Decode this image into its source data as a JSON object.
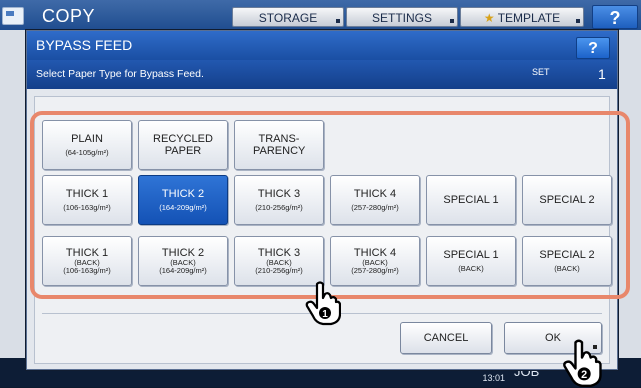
{
  "topbar": {
    "title": "COPY",
    "buttons": [
      "STORAGE",
      "SETTINGS",
      "TEMPLATE"
    ],
    "help_label": "?"
  },
  "dialog": {
    "title": "BYPASS FEED",
    "help_label": "?",
    "instruction": "Select Paper Type for Bypass Feed.",
    "set_label": "SET",
    "set_value": "1"
  },
  "paper_types": [
    {
      "label": "PLAIN",
      "weight": "(64-105g/m²)"
    },
    {
      "label": "RECYCLED PAPER"
    },
    {
      "label": "TRANS- PARENCY"
    },
    {
      "label": "THICK 1",
      "weight": "(106-163g/m²)"
    },
    {
      "label": "THICK 2",
      "weight": "(164-209g/m²)",
      "selected": true
    },
    {
      "label": "THICK 3",
      "weight": "(210-256g/m²)"
    },
    {
      "label": "THICK 4",
      "weight": "(257-280g/m²)"
    },
    {
      "label": "SPECIAL 1"
    },
    {
      "label": "SPECIAL 2"
    },
    {
      "label": "THICK 1",
      "back": "(BACK)",
      "weight": "(106-163g/m²)"
    },
    {
      "label": "THICK 2",
      "back": "(BACK)",
      "weight": "(164-209g/m²)"
    },
    {
      "label": "THICK 3",
      "back": "(BACK)",
      "weight": "(210-256g/m²)"
    },
    {
      "label": "THICK 4",
      "back": "(BACK)",
      "weight": "(257-280g/m²)"
    },
    {
      "label": "SPECIAL 1",
      "back": "(BACK)"
    },
    {
      "label": "SPECIAL 2",
      "back": "(BACK)"
    }
  ],
  "actions": {
    "cancel": "CANCEL",
    "ok": "OK"
  },
  "callouts": {
    "step1": "1",
    "step2": "2"
  },
  "status": {
    "time": "13:01",
    "job": "JOB"
  },
  "colors": {
    "highlight": "#e8876b",
    "selected": "#1a5cc4",
    "header": "#1f56ad"
  },
  "icons": [
    "pointing-hand-icon"
  ]
}
